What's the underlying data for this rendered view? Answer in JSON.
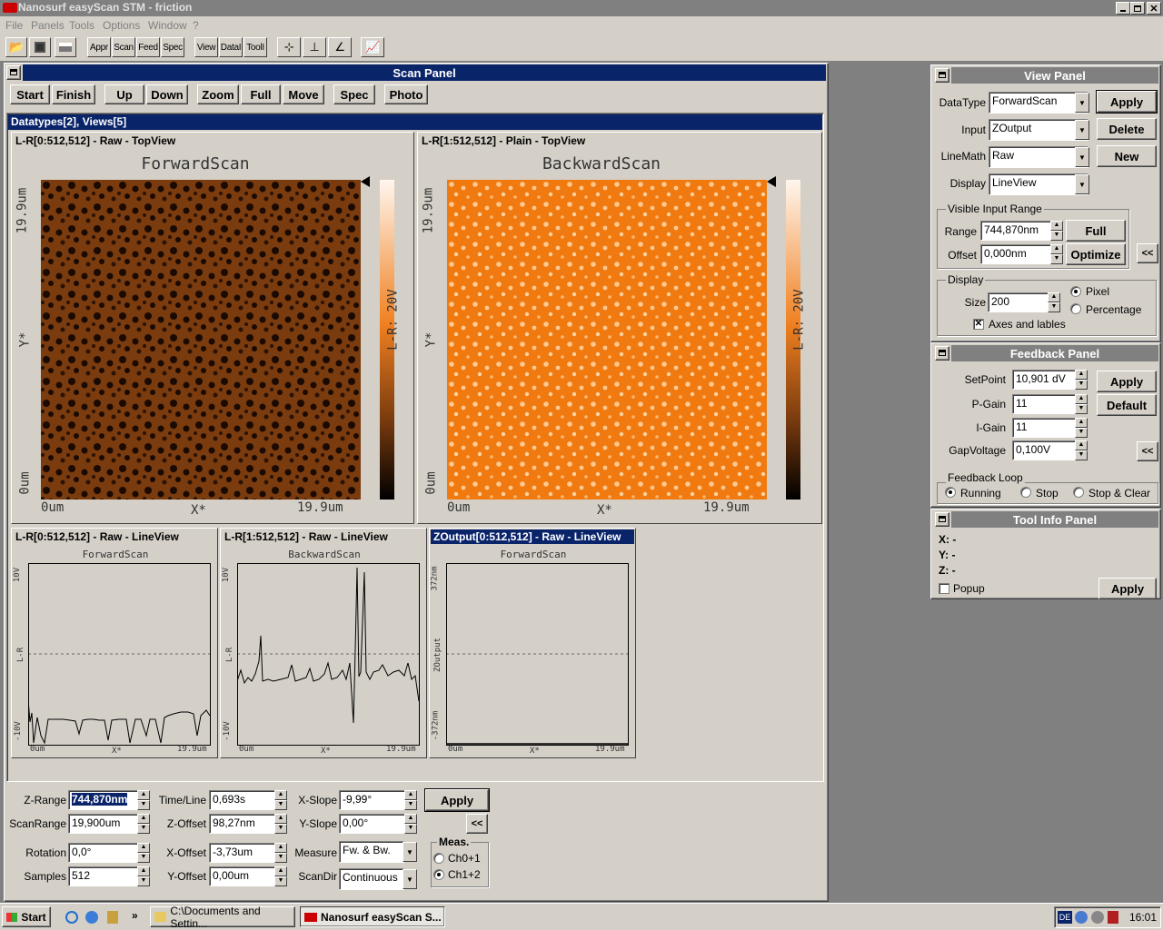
{
  "window": {
    "title": "Nanosurf easyScan STM - friction"
  },
  "menu": [
    "File",
    "Panels",
    "Tools",
    "Options",
    "Window",
    "?"
  ],
  "toolbar": {
    "buttons": [
      "Appr",
      "Scan",
      "Feed",
      "Spec",
      "View",
      "DataI",
      "ToolI"
    ]
  },
  "scan_panel": {
    "title": "Scan Panel",
    "buttons": [
      "Start",
      "Finish",
      "Up",
      "Down",
      "Zoom",
      "Full",
      "Move",
      "Spec",
      "Photo"
    ],
    "datatypes_title": "Datatypes[2], Views[5]",
    "views": [
      {
        "header": "L-R[0:512,512] - Raw - TopView",
        "title": "ForwardScan",
        "x0": "0um",
        "x1": "19.9um",
        "xl": "X*",
        "y0": "0um",
        "y1": "19.9um",
        "yl": "Y*",
        "cbar": "L-R: 20V"
      },
      {
        "header": "L-R[1:512,512] - Plain - TopView",
        "title": "BackwardScan",
        "x0": "0um",
        "x1": "19.9um",
        "xl": "X*",
        "y0": "0um",
        "y1": "19.9um",
        "yl": "Y*",
        "cbar": "L-R: 20V"
      }
    ],
    "lineviews": [
      {
        "header": "L-R[0:512,512] - Raw - LineView",
        "title": "ForwardScan",
        "ytop": "10V",
        "ymid": "L-R",
        "ybot": "-10V",
        "x0": "0um",
        "xl": "X*",
        "x1": "19.9um"
      },
      {
        "header": "L-R[1:512,512] - Raw - LineView",
        "title": "BackwardScan",
        "ytop": "10V",
        "ymid": "L-R",
        "ybot": "-10V",
        "x0": "0um",
        "xl": "X*",
        "x1": "19.9um"
      },
      {
        "header": "ZOutput[0:512,512] - Raw - LineView",
        "title": "ForwardScan",
        "ytop": "372nm",
        "ymid": "ZOutput",
        "ybot": "-372nm",
        "x0": "0um",
        "xl": "X*",
        "x1": "19.9um"
      }
    ]
  },
  "params": {
    "z_range": {
      "label": "Z-Range",
      "value": "744,870nm"
    },
    "scan_range": {
      "label": "ScanRange",
      "value": "19,900um"
    },
    "rotation": {
      "label": "Rotation",
      "value": "0,0°"
    },
    "samples": {
      "label": "Samples",
      "value": "512"
    },
    "time_line": {
      "label": "Time/Line",
      "value": "0,693s"
    },
    "z_offset": {
      "label": "Z-Offset",
      "value": "98,27nm"
    },
    "x_offset": {
      "label": "X-Offset",
      "value": "-3,73um"
    },
    "y_offset": {
      "label": "Y-Offset",
      "value": "0,00um"
    },
    "x_slope": {
      "label": "X-Slope",
      "value": "-9,99°"
    },
    "y_slope": {
      "label": "Y-Slope",
      "value": "0,00°"
    },
    "measure": {
      "label": "Measure",
      "value": "Fw. & Bw."
    },
    "scandir": {
      "label": "ScanDir",
      "value": "Continuous"
    },
    "apply": "Apply",
    "collapse": "<<",
    "meas": {
      "label": "Meas.",
      "opt1": "Ch0+1",
      "opt2": "Ch1+2"
    }
  },
  "view_panel": {
    "title": "View Panel",
    "datatype": {
      "label": "DataType",
      "value": "ForwardScan"
    },
    "input": {
      "label": "Input",
      "value": "ZOutput"
    },
    "linemath": {
      "label": "LineMath",
      "value": "Raw"
    },
    "display": {
      "label": "Display",
      "value": "LineView"
    },
    "apply": "Apply",
    "delete": "Delete",
    "new": "New",
    "vir": {
      "label": "Visible Input Range",
      "range_label": "Range",
      "range": "744,870nm",
      "offset_label": "Offset",
      "offset": "0,000nm",
      "full": "Full",
      "optimize": "Optimize"
    },
    "disp": {
      "label": "Display",
      "size_label": "Size",
      "size": "200",
      "pixel": "Pixel",
      "percentage": "Percentage",
      "axes": "Axes and lables"
    },
    "collapse": "<<"
  },
  "feedback_panel": {
    "title": "Feedback Panel",
    "setpoint": {
      "label": "SetPoint",
      "value": "10,901 dV"
    },
    "pgain": {
      "label": "P-Gain",
      "value": "11"
    },
    "igain": {
      "label": "I-Gain",
      "value": "11"
    },
    "gap": {
      "label": "GapVoltage",
      "value": "0,100V"
    },
    "apply": "Apply",
    "default": "Default",
    "collapse": "<<",
    "loop": {
      "label": "Feedback Loop",
      "running": "Running",
      "stop": "Stop",
      "stop_clear": "Stop & Clear"
    }
  },
  "tool_info": {
    "title": "Tool Info Panel",
    "x": "X: -",
    "y": "Y: -",
    "z": "Z: -",
    "popup": "Popup",
    "apply": "Apply"
  },
  "taskbar": {
    "start": "Start",
    "tasks": [
      "C:\\Documents and Settin...",
      "Nanosurf easyScan S..."
    ],
    "lang": "DE",
    "time": "16:01"
  }
}
